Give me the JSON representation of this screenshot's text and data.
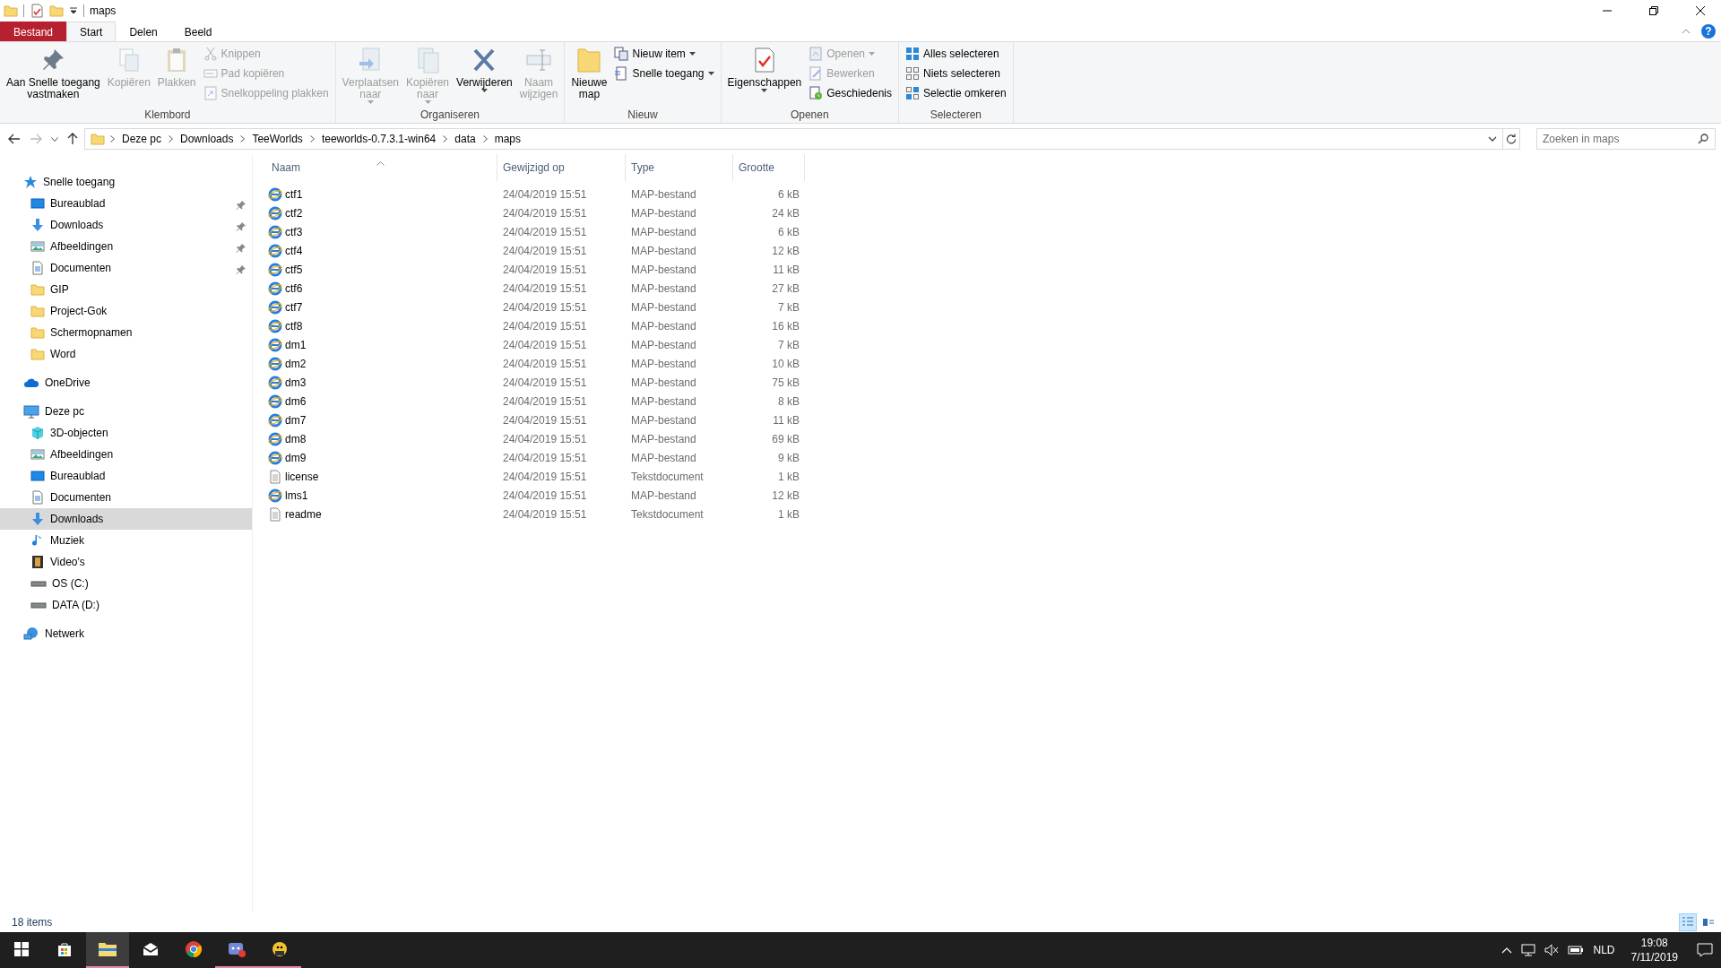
{
  "window": {
    "title": "maps"
  },
  "ribbon_tabs": [
    {
      "label": "Bestand",
      "kind": "file",
      "selected": false
    },
    {
      "label": "Start",
      "kind": "tab",
      "selected": true
    },
    {
      "label": "Delen",
      "kind": "tab",
      "selected": false
    },
    {
      "label": "Beeld",
      "kind": "tab",
      "selected": false
    }
  ],
  "help": {
    "label": "?"
  },
  "ribbon_groups": [
    {
      "label": "Klembord",
      "items": [
        {
          "kind": "large",
          "label": "Aan Snelle toegang\nvastmaken",
          "disabled": false,
          "dropdown": false
        },
        {
          "kind": "large",
          "label": "Kopiëren",
          "disabled": true,
          "dropdown": false
        },
        {
          "kind": "large",
          "label": "Plakken",
          "disabled": true,
          "dropdown": false
        },
        {
          "kind": "small",
          "label": "Knippen",
          "disabled": true,
          "dropdown": false
        },
        {
          "kind": "small",
          "label": "Pad kopiëren",
          "disabled": true,
          "dropdown": false
        },
        {
          "kind": "small",
          "label": "Snelkoppeling plakken",
          "disabled": true,
          "dropdown": false
        }
      ]
    },
    {
      "label": "Organiseren",
      "items": [
        {
          "kind": "large",
          "label": "Verplaatsen\nnaar",
          "disabled": true,
          "dropdown": true
        },
        {
          "kind": "large",
          "label": "Kopiëren\nnaar",
          "disabled": true,
          "dropdown": true
        },
        {
          "kind": "large",
          "label": "Verwijderen",
          "disabled": false,
          "dropdown": true
        },
        {
          "kind": "large",
          "label": "Naam\nwijzigen",
          "disabled": true,
          "dropdown": false
        }
      ]
    },
    {
      "label": "Nieuw",
      "items": [
        {
          "kind": "large",
          "label": "Nieuwe\nmap",
          "disabled": false,
          "dropdown": false
        },
        {
          "kind": "small",
          "label": "Nieuw item",
          "disabled": false,
          "dropdown": true
        },
        {
          "kind": "small",
          "label": "Snelle toegang",
          "disabled": false,
          "dropdown": true
        }
      ]
    },
    {
      "label": "Openen",
      "items": [
        {
          "kind": "large",
          "label": "Eigenschappen",
          "disabled": false,
          "dropdown": true
        },
        {
          "kind": "small",
          "label": "Openen",
          "disabled": true,
          "dropdown": true
        },
        {
          "kind": "small",
          "label": "Bewerken",
          "disabled": true,
          "dropdown": false
        },
        {
          "kind": "small",
          "label": "Geschiedenis",
          "disabled": false,
          "dropdown": false
        }
      ]
    },
    {
      "label": "Selecteren",
      "items": [
        {
          "kind": "small",
          "label": "Alles selecteren",
          "disabled": false,
          "dropdown": false
        },
        {
          "kind": "small",
          "label": "Niets selecteren",
          "disabled": false,
          "dropdown": false
        },
        {
          "kind": "small",
          "label": "Selectie omkeren",
          "disabled": false,
          "dropdown": false
        }
      ]
    }
  ],
  "address": {
    "crumbs": [
      "Deze pc",
      "Downloads",
      "TeeWorlds",
      "teeworlds-0.7.3.1-win64",
      "data",
      "maps"
    ],
    "search_placeholder": "Zoeken in maps"
  },
  "sidebar": [
    {
      "label": "Snelle toegang",
      "kind": "quick",
      "selected": false,
      "children": [
        {
          "label": "Bureaublad",
          "kind": "desktop",
          "selected": false,
          "pinned": true
        },
        {
          "label": "Downloads",
          "kind": "downloads",
          "selected": false,
          "pinned": true
        },
        {
          "label": "Afbeeldingen",
          "kind": "pictures",
          "selected": false,
          "pinned": true
        },
        {
          "label": "Documenten",
          "kind": "documents",
          "selected": false,
          "pinned": true
        },
        {
          "label": "GIP",
          "kind": "folder",
          "selected": false,
          "pinned": false
        },
        {
          "label": "Project-Gok",
          "kind": "folder",
          "selected": false,
          "pinned": false
        },
        {
          "label": "Schermopnamen",
          "kind": "folder",
          "selected": false,
          "pinned": false
        },
        {
          "label": "Word",
          "kind": "folder",
          "selected": false,
          "pinned": false
        }
      ]
    },
    {
      "label": "OneDrive",
      "kind": "cloud",
      "selected": false
    },
    {
      "label": "Deze pc",
      "kind": "pc",
      "selected": false,
      "children": [
        {
          "label": "3D-objecten",
          "kind": "cube",
          "selected": false
        },
        {
          "label": "Afbeeldingen",
          "kind": "pictures",
          "selected": false
        },
        {
          "label": "Bureaublad",
          "kind": "desktop",
          "selected": false
        },
        {
          "label": "Documenten",
          "kind": "documents",
          "selected": false
        },
        {
          "label": "Downloads",
          "kind": "downloads",
          "selected": true
        },
        {
          "label": "Muziek",
          "kind": "music",
          "selected": false
        },
        {
          "label": "Video's",
          "kind": "videos",
          "selected": false
        },
        {
          "label": "OS (C:)",
          "kind": "drive",
          "selected": false
        },
        {
          "label": "DATA (D:)",
          "kind": "drive",
          "selected": false
        }
      ]
    },
    {
      "label": "Netwerk",
      "kind": "network",
      "selected": false
    }
  ],
  "files": {
    "columns": [
      "Naam",
      "Gewijzigd op",
      "Type",
      "Grootte"
    ],
    "rows": [
      {
        "name": "ctf1",
        "modified": "24/04/2019 15:51",
        "type": "MAP-bestand",
        "size": "6 kB",
        "kind": "map"
      },
      {
        "name": "ctf2",
        "modified": "24/04/2019 15:51",
        "type": "MAP-bestand",
        "size": "24 kB",
        "kind": "map"
      },
      {
        "name": "ctf3",
        "modified": "24/04/2019 15:51",
        "type": "MAP-bestand",
        "size": "6 kB",
        "kind": "map"
      },
      {
        "name": "ctf4",
        "modified": "24/04/2019 15:51",
        "type": "MAP-bestand",
        "size": "12 kB",
        "kind": "map"
      },
      {
        "name": "ctf5",
        "modified": "24/04/2019 15:51",
        "type": "MAP-bestand",
        "size": "11 kB",
        "kind": "map"
      },
      {
        "name": "ctf6",
        "modified": "24/04/2019 15:51",
        "type": "MAP-bestand",
        "size": "27 kB",
        "kind": "map"
      },
      {
        "name": "ctf7",
        "modified": "24/04/2019 15:51",
        "type": "MAP-bestand",
        "size": "7 kB",
        "kind": "map"
      },
      {
        "name": "ctf8",
        "modified": "24/04/2019 15:51",
        "type": "MAP-bestand",
        "size": "16 kB",
        "kind": "map"
      },
      {
        "name": "dm1",
        "modified": "24/04/2019 15:51",
        "type": "MAP-bestand",
        "size": "7 kB",
        "kind": "map"
      },
      {
        "name": "dm2",
        "modified": "24/04/2019 15:51",
        "type": "MAP-bestand",
        "size": "10 kB",
        "kind": "map"
      },
      {
        "name": "dm3",
        "modified": "24/04/2019 15:51",
        "type": "MAP-bestand",
        "size": "75 kB",
        "kind": "map"
      },
      {
        "name": "dm6",
        "modified": "24/04/2019 15:51",
        "type": "MAP-bestand",
        "size": "8 kB",
        "kind": "map"
      },
      {
        "name": "dm7",
        "modified": "24/04/2019 15:51",
        "type": "MAP-bestand",
        "size": "11 kB",
        "kind": "map"
      },
      {
        "name": "dm8",
        "modified": "24/04/2019 15:51",
        "type": "MAP-bestand",
        "size": "69 kB",
        "kind": "map"
      },
      {
        "name": "dm9",
        "modified": "24/04/2019 15:51",
        "type": "MAP-bestand",
        "size": "9 kB",
        "kind": "map"
      },
      {
        "name": "license",
        "modified": "24/04/2019 15:51",
        "type": "Tekstdocument",
        "size": "1 kB",
        "kind": "text"
      },
      {
        "name": "lms1",
        "modified": "24/04/2019 15:51",
        "type": "MAP-bestand",
        "size": "12 kB",
        "kind": "map"
      },
      {
        "name": "readme",
        "modified": "24/04/2019 15:51",
        "type": "Tekstdocument",
        "size": "1 kB",
        "kind": "text"
      }
    ]
  },
  "status_bar": {
    "count": "18 items",
    "views": [
      {
        "kind": "details",
        "selected": true
      },
      {
        "kind": "tiles",
        "selected": false
      }
    ]
  },
  "taskbar": {
    "apps": [
      {
        "kind": "store",
        "selected": false,
        "running": false
      },
      {
        "kind": "explorer",
        "selected": true,
        "running": true
      },
      {
        "kind": "mail",
        "selected": false,
        "running": false
      },
      {
        "kind": "chrome",
        "selected": false,
        "running": false
      },
      {
        "kind": "controller",
        "selected": false,
        "running": true
      },
      {
        "kind": "character",
        "selected": false,
        "running": true
      }
    ],
    "language": "NLD",
    "time": "19:08",
    "date": "7/11/2019"
  }
}
